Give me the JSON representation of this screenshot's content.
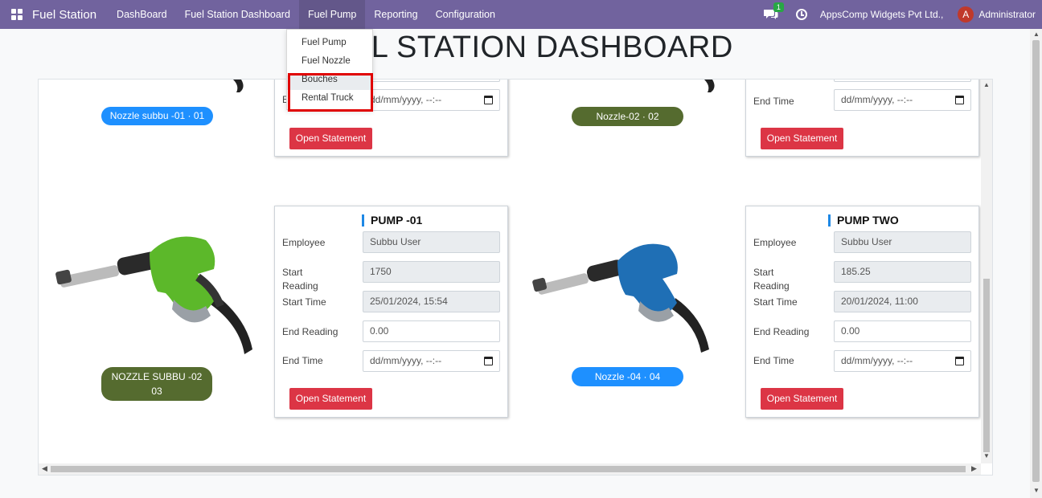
{
  "navbar": {
    "brand": "Fuel Station",
    "menu": [
      "DashBoard",
      "Fuel Station Dashboard",
      "Fuel Pump",
      "Reporting",
      "Configuration"
    ],
    "active_menu": "Fuel Pump",
    "message_badge": "1",
    "company": "AppsComp Widgets Pvt Ltd.,",
    "avatar_letter": "A",
    "user": "Administrator"
  },
  "page": {
    "title": "FUEL STATION DASHBOARD"
  },
  "dropdown": {
    "items": [
      "Fuel Pump",
      "Fuel Nozzle",
      "Bouches",
      "Rental Truck"
    ]
  },
  "labels": {
    "employee": "Employee",
    "start": "Start",
    "reading": "Reading",
    "start_time": "Start Time",
    "end_reading": "End Reading",
    "end_time": "End Time",
    "open_statement": "Open Statement",
    "date_placeholder": "dd/mm/yyyy, --:--",
    "end_time_abbrev": "E"
  },
  "cards": [
    {
      "title": "PUMP -01",
      "employee": "Subbu User",
      "start_reading": "1750",
      "start_time": "25/01/2024, 15:54",
      "end_reading": "0.00",
      "end_time": "dd/mm/yyyy, --:--"
    },
    {
      "title": "PUMP TWO",
      "employee": "Subbu User",
      "start_reading": "185.25",
      "start_time": "20/01/2024, 11:00",
      "end_reading": "0.00",
      "end_time": "dd/mm/yyyy, --:--"
    }
  ],
  "nozzles": [
    {
      "label": "Nozzle subbu -01 · 01",
      "color": "#1e90ff"
    },
    {
      "label": "Nozzle-02 · 02",
      "color": "#556b2f"
    },
    {
      "label_line1": "NOZZLE SUBBU -02",
      "label_line2": "03",
      "color": "#556b2f"
    },
    {
      "label": "Nozzle -04 · 04",
      "color": "#1e90ff"
    }
  ],
  "colors": {
    "navbar": "#71639e",
    "button_red": "#dc3545",
    "nozzle_green": "#5cb82a",
    "nozzle_blue": "#1f6fb5",
    "highlight_red": "#e00000"
  }
}
